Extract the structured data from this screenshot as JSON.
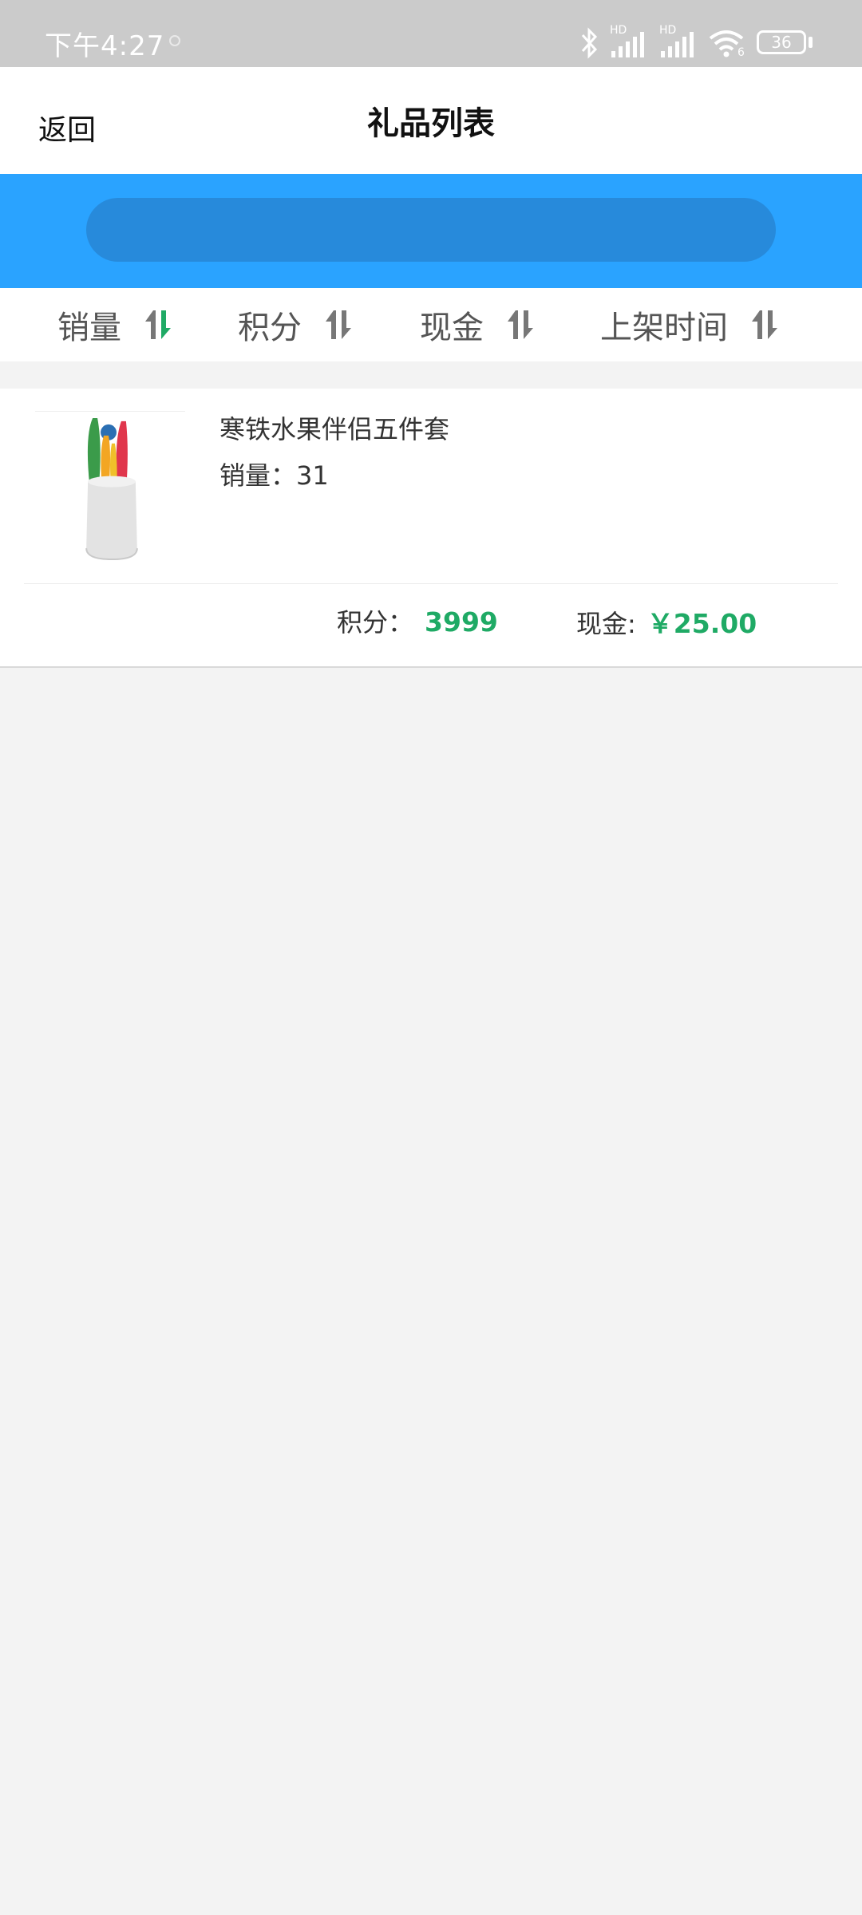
{
  "status_bar": {
    "time": "下午4:27",
    "battery": "36",
    "network_tag_1": "HD",
    "network_tag_2": "HD",
    "wifi_tag": "6"
  },
  "header": {
    "back_label": "返回",
    "title": "礼品列表"
  },
  "search": {
    "placeholder": ""
  },
  "sort_bar": {
    "items": [
      {
        "label": "销量",
        "active": true
      },
      {
        "label": "积分",
        "active": false
      },
      {
        "label": "现金",
        "active": false
      },
      {
        "label": "上架时间",
        "active": false
      }
    ]
  },
  "gifts": [
    {
      "name": "寒铁水果伴侣五件套",
      "sales_label": "销量：",
      "sales_value": "31",
      "points_label": "积分：",
      "points_value": "3999",
      "cash_label": "现金:",
      "cash_value": "￥25.00"
    }
  ],
  "colors": {
    "accent_blue": "#2aa3ff",
    "search_fill": "#278adb",
    "price_green": "#1faa65",
    "sort_active": "#1faa65",
    "sort_inactive": "#777777"
  }
}
